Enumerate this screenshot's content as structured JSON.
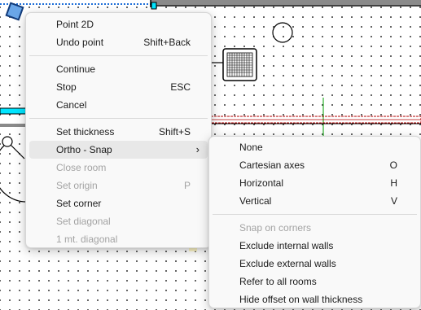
{
  "main_menu": {
    "items": [
      {
        "label": "Point 2D",
        "shortcut": ""
      },
      {
        "label": "Undo point",
        "shortcut": "Shift+Back"
      },
      {
        "label": "Continue",
        "shortcut": ""
      },
      {
        "label": "Stop",
        "shortcut": "ESC"
      },
      {
        "label": "Cancel",
        "shortcut": ""
      },
      {
        "label": "Set thickness",
        "shortcut": "Shift+S"
      },
      {
        "label": "Ortho - Snap",
        "shortcut": ""
      },
      {
        "label": "Close room",
        "shortcut": ""
      },
      {
        "label": "Set origin",
        "shortcut": "P"
      },
      {
        "label": "Set corner",
        "shortcut": ""
      },
      {
        "label": "Set diagonal",
        "shortcut": ""
      },
      {
        "label": "1 mt. diagonal",
        "shortcut": ""
      }
    ]
  },
  "sub_menu": {
    "items": [
      {
        "label": "None",
        "shortcut": ""
      },
      {
        "label": "Cartesian axes",
        "shortcut": "O"
      },
      {
        "label": "Horizontal",
        "shortcut": "H"
      },
      {
        "label": "Vertical",
        "shortcut": "V"
      },
      {
        "label": "Snap on corners",
        "shortcut": ""
      },
      {
        "label": "Exclude internal walls",
        "shortcut": ""
      },
      {
        "label": "Exclude external walls",
        "shortcut": ""
      },
      {
        "label": "Refer to all rooms",
        "shortcut": ""
      },
      {
        "label": "Hide offset on wall thickness",
        "shortcut": ""
      }
    ]
  },
  "icons": {
    "submenu_arrow": "chevron-right-icon"
  },
  "colors": {
    "selection_blue": "#0078d7",
    "wall_cyan": "#00e5ff",
    "wall_gray": "#8a8a8a",
    "axis_green": "#00a000",
    "dimension_red": "#c00000"
  }
}
